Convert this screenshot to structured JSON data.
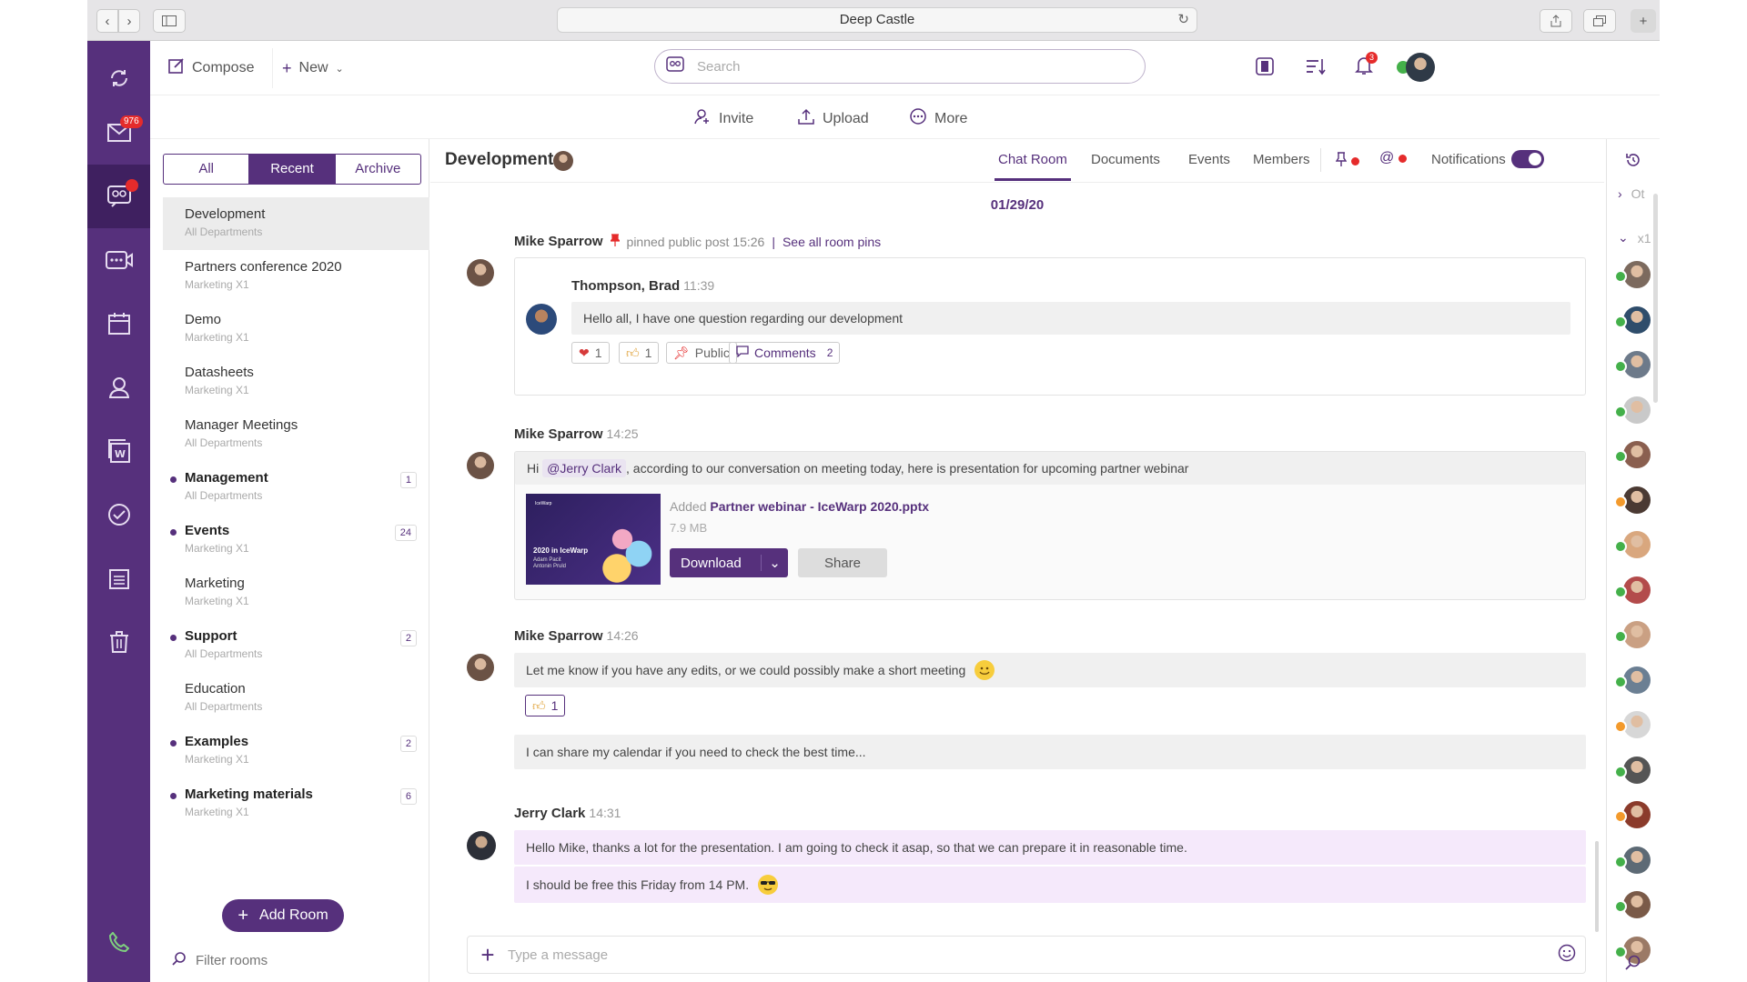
{
  "window": {
    "title": "Deep Castle"
  },
  "rail": {
    "mail_badge": "976"
  },
  "topbar": {
    "compose_label": "Compose",
    "new_label": "New",
    "search_placeholder": "Search",
    "notifications_badge": "3"
  },
  "subbar": {
    "invite_label": "Invite",
    "upload_label": "Upload",
    "more_label": "More"
  },
  "rooms": {
    "filters": [
      "All",
      "Recent",
      "Archive"
    ],
    "active_filter": "Recent",
    "items": [
      {
        "name": "Development",
        "sub": "All Departments",
        "bold": false,
        "count": "",
        "selected": true
      },
      {
        "name": "Partners conference 2020",
        "sub": "Marketing X1",
        "bold": false,
        "count": ""
      },
      {
        "name": "Demo",
        "sub": "Marketing X1",
        "bold": false,
        "count": ""
      },
      {
        "name": "Datasheets",
        "sub": "Marketing X1",
        "bold": false,
        "count": ""
      },
      {
        "name": "Manager Meetings",
        "sub": "All Departments",
        "bold": false,
        "count": ""
      },
      {
        "name": "Management",
        "sub": "All Departments",
        "bold": true,
        "count": "1"
      },
      {
        "name": "Events",
        "sub": "Marketing X1",
        "bold": true,
        "count": "24"
      },
      {
        "name": "Marketing",
        "sub": "Marketing X1",
        "bold": false,
        "count": ""
      },
      {
        "name": "Support",
        "sub": "All Departments",
        "bold": true,
        "count": "2"
      },
      {
        "name": "Education",
        "sub": "All Departments",
        "bold": false,
        "count": ""
      },
      {
        "name": "Examples",
        "sub": "Marketing X1",
        "bold": true,
        "count": "2"
      },
      {
        "name": "Marketing materials",
        "sub": "Marketing X1",
        "bold": true,
        "count": "6"
      }
    ],
    "add_room_label": "Add Room",
    "filter_placeholder": "Filter rooms"
  },
  "chat": {
    "room_title": "Development",
    "tabs": [
      "Chat Room",
      "Documents",
      "Events",
      "Members"
    ],
    "active_tab": "Chat Room",
    "notifications_label": "Notifications",
    "notifications_on": true,
    "date": "01/29/20",
    "pin_notice": {
      "author": "Mike Sparrow",
      "text": "pinned public post 15:26",
      "link": "See all room pins"
    },
    "pinned_post": {
      "author": "Thompson, Brad",
      "time": "11:39",
      "text": "Hello all, I have one question regarding our development",
      "heart_count": "1",
      "like_count": "1",
      "public_label": "Public",
      "comments_label": "Comments",
      "comments_count": "2"
    },
    "msg1": {
      "author": "Mike Sparrow",
      "time": "14:25",
      "pre": "Hi",
      "mention": "@Jerry Clark",
      "post": ", according to our conversation on meeting today, here is presentation for upcoming partner webinar",
      "attachment": {
        "added_label": "Added",
        "file_name": "Partner webinar - IceWarp 2020.pptx",
        "file_size": "7.9 MB",
        "thumb_brand": "IceWarp",
        "thumb_title": "2020 in IceWarp",
        "thumb_names": "Adam Pacit\nAntonin Pruld",
        "download_label": "Download",
        "share_label": "Share"
      }
    },
    "msg2": {
      "author": "Mike Sparrow",
      "time": "14:26",
      "text1": "Let me know if you have any edits, or we could possibly make a short meeting",
      "like_count": "1",
      "text2": "I can share my calendar if you need to check the best time..."
    },
    "msg3": {
      "author": "Jerry Clark",
      "time": "14:31",
      "text1": "Hello Mike, thanks a lot for the presentation. I am going to check it asap, so that we can prepare it in reasonable time.",
      "text2": "I should be free this Friday from 14 PM."
    },
    "composer_placeholder": "Type a message"
  },
  "members": {
    "group_collapsed": "Ot",
    "group_expanded": "x1",
    "statuses": [
      "online",
      "online",
      "online",
      "online",
      "online",
      "away",
      "online",
      "online",
      "online",
      "online",
      "away",
      "online",
      "away",
      "online",
      "online",
      "online"
    ]
  },
  "colors": {
    "brand": "#56307c",
    "rail_active": "#3f2060",
    "badge": "#e52b2b",
    "online": "#44b04a",
    "away": "#f39a2c"
  }
}
